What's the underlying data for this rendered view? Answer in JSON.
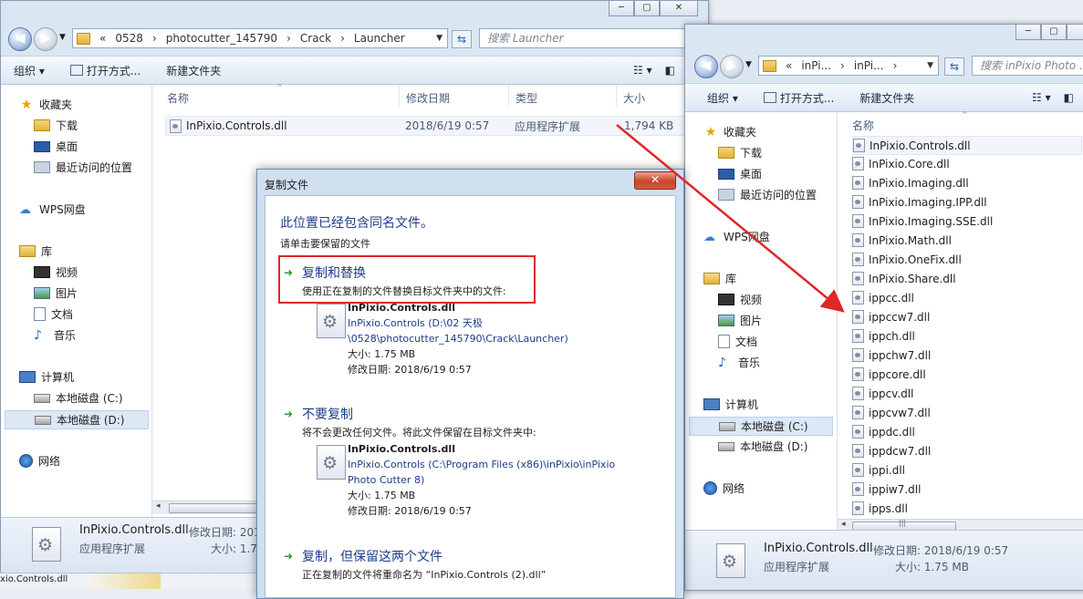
{
  "left_window": {
    "back_icon": "back-arrow-icon",
    "forward_icon": "forward-arrow-icon",
    "breadcrumb": [
      "«",
      "0528",
      "photocutter_145790",
      "Crack",
      "Launcher"
    ],
    "search_placeholder": "搜索 Launcher",
    "toolbar": {
      "organize": "组织 ▾",
      "open_with": "打开方式...",
      "new_folder": "新建文件夹"
    },
    "nav": {
      "favorites": "收藏夹",
      "downloads": "下载",
      "desktop": "桌面",
      "recent": "最近访问的位置",
      "wps": "WPS网盘",
      "libraries": "库",
      "videos": "视频",
      "pictures": "图片",
      "documents": "文档",
      "music": "音乐",
      "computer": "计算机",
      "drive_c": "本地磁盘 (C:)",
      "drive_d": "本地磁盘 (D:)",
      "network": "网络"
    },
    "columns": {
      "name": "名称",
      "modified": "修改日期",
      "type": "类型",
      "size": "大小"
    },
    "file": {
      "name": "InPixio.Controls.dll",
      "modified": "2018/6/19 0:57",
      "type": "应用程序扩展",
      "size": "1,794 KB"
    },
    "details": {
      "name": "InPixio.Controls.dll",
      "modified_label": "修改日期: 201",
      "type": "应用程序扩展",
      "size_label": "大小: 1.75"
    }
  },
  "right_window": {
    "breadcrumb": [
      "«",
      "inPi...",
      "inPi..."
    ],
    "search_placeholder": "搜索 inPixio Photo ...",
    "toolbar": {
      "organize": "组织 ▾",
      "open_with": "打开方式...",
      "new_folder": "新建文件夹"
    },
    "nav": {
      "favorites": "收藏夹",
      "downloads": "下载",
      "desktop": "桌面",
      "recent": "最近访问的位置",
      "wps": "WPS网盘",
      "libraries": "库",
      "videos": "视频",
      "pictures": "图片",
      "documents": "文档",
      "music": "音乐",
      "computer": "计算机",
      "drive_c": "本地磁盘 (C:)",
      "drive_d": "本地磁盘 (D:)",
      "network": "网络"
    },
    "column_name": "名称",
    "files": [
      "InPixio.Controls.dll",
      "InPixio.Core.dll",
      "InPixio.Imaging.dll",
      "InPixio.Imaging.IPP.dll",
      "InPixio.Imaging.SSE.dll",
      "InPixio.Math.dll",
      "InPixio.OneFix.dll",
      "InPixio.Share.dll",
      "ippcc.dll",
      "ippccw7.dll",
      "ippch.dll",
      "ippchw7.dll",
      "ippcore.dll",
      "ippcv.dll",
      "ippcvw7.dll",
      "ippdc.dll",
      "ippdcw7.dll",
      "ippi.dll",
      "ippiw7.dll",
      "ipps.dll"
    ],
    "details": {
      "name": "InPixio.Controls.dll",
      "modified": "修改日期: 2018/6/19 0:57",
      "type": "应用程序扩展",
      "size": "大小: 1.75 MB"
    }
  },
  "dialog": {
    "title": "复制文件",
    "close": "✕",
    "heading": "此位置已经包含同名文件。",
    "subheading": "请单击要保留的文件",
    "option_replace": {
      "title": "复制和替换",
      "desc": "使用正在复制的文件替换目标文件夹中的文件:",
      "file_name": "InPixio.Controls.dll",
      "path_line1": "InPixio.Controls (D:\\02 天极",
      "path_line2": "\\0528\\photocutter_145790\\Crack\\Launcher)",
      "size": "大小: 1.75 MB",
      "modified": "修改日期: 2018/6/19 0:57"
    },
    "option_skip": {
      "title": "不要复制",
      "desc": "将不会更改任何文件。将此文件保留在目标文件夹中:",
      "file_name": "InPixio.Controls.dll",
      "path_line1": "InPixio.Controls (C:\\Program Files (x86)\\inPixio\\inPixio",
      "path_line2": "Photo Cutter 8)",
      "size": "大小: 1.75 MB",
      "modified": "修改日期: 2018/6/19 0:57"
    },
    "option_keep_both": {
      "title": "复制，但保留这两个文件",
      "desc": "正在复制的文件将重命名为 “InPixio.Controls (2).dll”"
    }
  },
  "taskbar_label": "xio.Controls.dll",
  "colors": {
    "highlight": "#e0262a",
    "link_blue": "#1c3d8a",
    "arrow_green": "#2f9a2f"
  }
}
